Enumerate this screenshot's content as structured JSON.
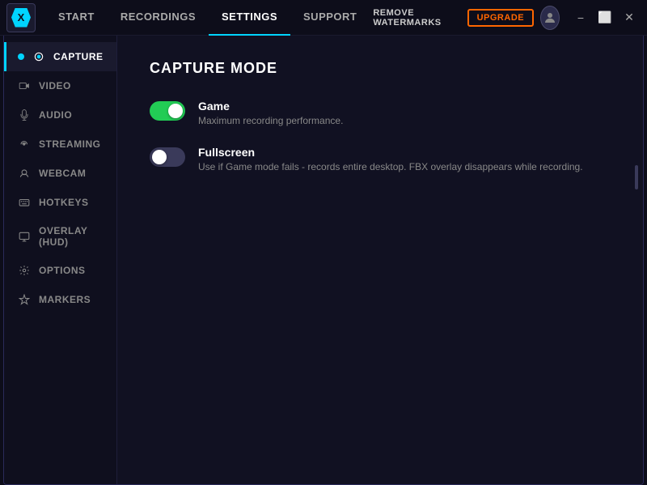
{
  "titlebar": {
    "logo_text": "X",
    "nav_tabs": [
      {
        "id": "start",
        "label": "START",
        "active": false
      },
      {
        "id": "recordings",
        "label": "RECORDINGS",
        "active": false
      },
      {
        "id": "settings",
        "label": "SETTINGS",
        "active": true
      },
      {
        "id": "support",
        "label": "SUPPORT",
        "active": false
      }
    ],
    "remove_watermarks_label": "REMOVE WATERMARKS",
    "upgrade_label": "UPGRADE",
    "window_controls": {
      "minimize": "−",
      "maximize": "⬜",
      "close": "✕"
    }
  },
  "sidebar": {
    "items": [
      {
        "id": "capture",
        "label": "CAPTURE",
        "icon": "record",
        "active": true
      },
      {
        "id": "video",
        "label": "VIDEO",
        "icon": "video",
        "active": false
      },
      {
        "id": "audio",
        "label": "AUDIO",
        "icon": "audio",
        "active": false
      },
      {
        "id": "streaming",
        "label": "STREAMING",
        "icon": "wifi",
        "active": false
      },
      {
        "id": "webcam",
        "label": "WEBCAM",
        "icon": "webcam",
        "active": false
      },
      {
        "id": "hotkeys",
        "label": "HOTKEYS",
        "icon": "keyboard",
        "active": false
      },
      {
        "id": "overlay",
        "label": "OVERLAY (HUD)",
        "icon": "monitor",
        "active": false
      },
      {
        "id": "options",
        "label": "OPTIONS",
        "icon": "gear",
        "active": false
      },
      {
        "id": "markers",
        "label": "MARKERS",
        "icon": "shield",
        "active": false
      }
    ]
  },
  "content": {
    "title": "CAPTURE MODE",
    "options": [
      {
        "id": "game",
        "label": "Game",
        "description": "Maximum recording performance.",
        "enabled": true
      },
      {
        "id": "fullscreen",
        "label": "Fullscreen",
        "description": "Use if Game mode fails - records entire desktop. FBX overlay disappears while recording.",
        "enabled": false
      }
    ]
  }
}
